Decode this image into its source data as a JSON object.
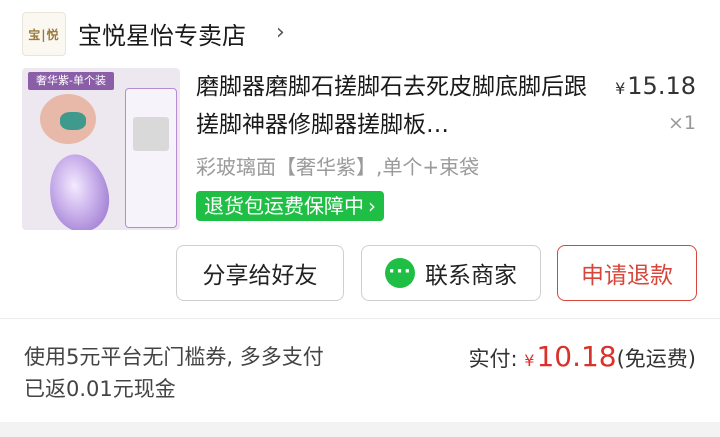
{
  "shop": {
    "logo_text": "宝|悦",
    "name": "宝悦星怡专卖店",
    "chevron": "›"
  },
  "product": {
    "thumbnail": {
      "tag": "奢华紫-单个装"
    },
    "title": "磨脚器磨脚石搓脚石去死皮脚底脚后跟搓脚神器修脚器搓脚板…",
    "price_currency": "¥",
    "price": "15.18",
    "quantity": "×1",
    "spec": "彩玻璃面【奢华紫】,单个+束袋",
    "guarantee": "退货包运费保障中",
    "guarantee_chevron": "›"
  },
  "actions": {
    "share_label": "分享给好友",
    "contact_label": "联系商家",
    "refund_label": "申请退款"
  },
  "footer": {
    "note": "使用5元平台无门槛券, 多多支付已返0.01元现金",
    "paid_label": "实付: ",
    "paid_currency": "¥",
    "paid_amount": "10.18",
    "shipping_note": "(免运费)"
  },
  "colors": {
    "accent_red": "#d9312b",
    "guarantee_green": "#1fbf45",
    "thumb_purple": "#8b5fa8"
  }
}
